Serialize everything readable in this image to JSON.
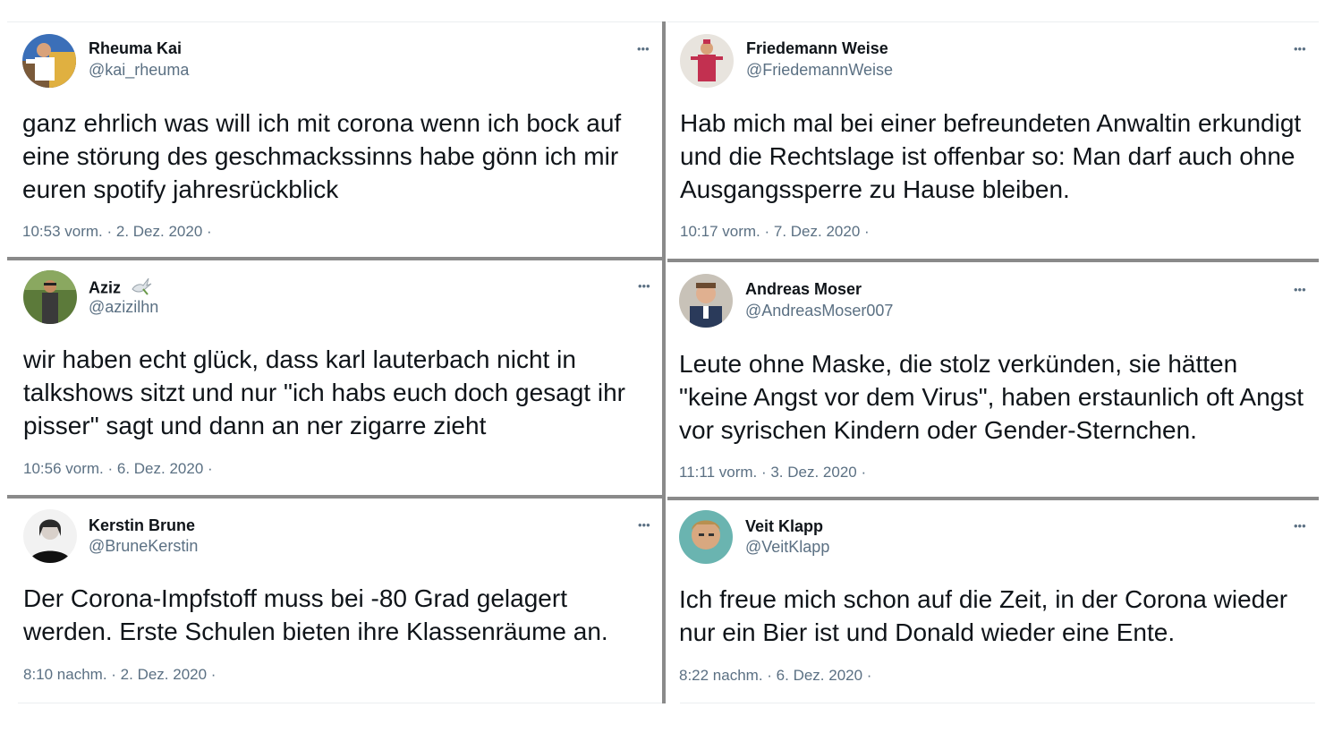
{
  "tweets": [
    {
      "name": "Rheuma Kai",
      "handle": "@kai_rheuma",
      "text": "ganz ehrlich was will ich mit corona wenn ich bock auf eine störung des geschmackssinns habe gönn ich mir euren spotify jahresrückblick",
      "meta": "10:53 vorm. · 2. Dez. 2020 ·",
      "more": "•••"
    },
    {
      "name": "Friedemann Weise",
      "handle": "@FriedemannWeise",
      "text": "Hab mich mal bei einer befreundeten Anwaltin erkundigt und die Rechtslage ist offenbar so: Man darf auch ohne Ausgangssperre zu Hause bleiben.",
      "meta": "10:17 vorm. · 7. Dez. 2020 ·",
      "more": "•••"
    },
    {
      "name": "Aziz",
      "handle": "@azizilhn",
      "text": "wir haben echt glück, dass karl lauterbach nicht in talkshows sitzt und nur \"ich habs euch doch gesagt ihr pisser\" sagt und dann an ner zigarre zieht",
      "meta": "10:56 vorm. · 6. Dez. 2020 ·",
      "more": "•••"
    },
    {
      "name": "Andreas Moser",
      "handle": "@AndreasMoser007",
      "text": "Leute ohne Maske, die stolz verkünden, sie hätten \"keine Angst vor dem Virus\", haben erstaunlich oft Angst vor syrischen Kindern oder Gender-Sternchen.",
      "meta": "11:11 vorm. · 3. Dez. 2020 ·",
      "more": "•••"
    },
    {
      "name": "Kerstin Brune",
      "handle": "@BruneKerstin",
      "text": "Der Corona-Impfstoff muss bei -80 Grad gelagert werden. Erste Schulen bieten ihre Klassenräume an.",
      "meta": "8:10 nachm. · 2. Dez. 2020 ·",
      "more": "•••"
    },
    {
      "name": "Veit Klapp",
      "handle": "@VeitKlapp",
      "text": "Ich freue mich schon auf die Zeit, in der Corona wieder nur ein Bier ist und Donald wieder eine Ente.",
      "meta": "8:22 nachm. · 6. Dez. 2020 ·",
      "more": "•••"
    }
  ],
  "colors": {
    "text": "#0f1419",
    "secondary": "#5b7083",
    "separator": "#8a8a8a"
  }
}
